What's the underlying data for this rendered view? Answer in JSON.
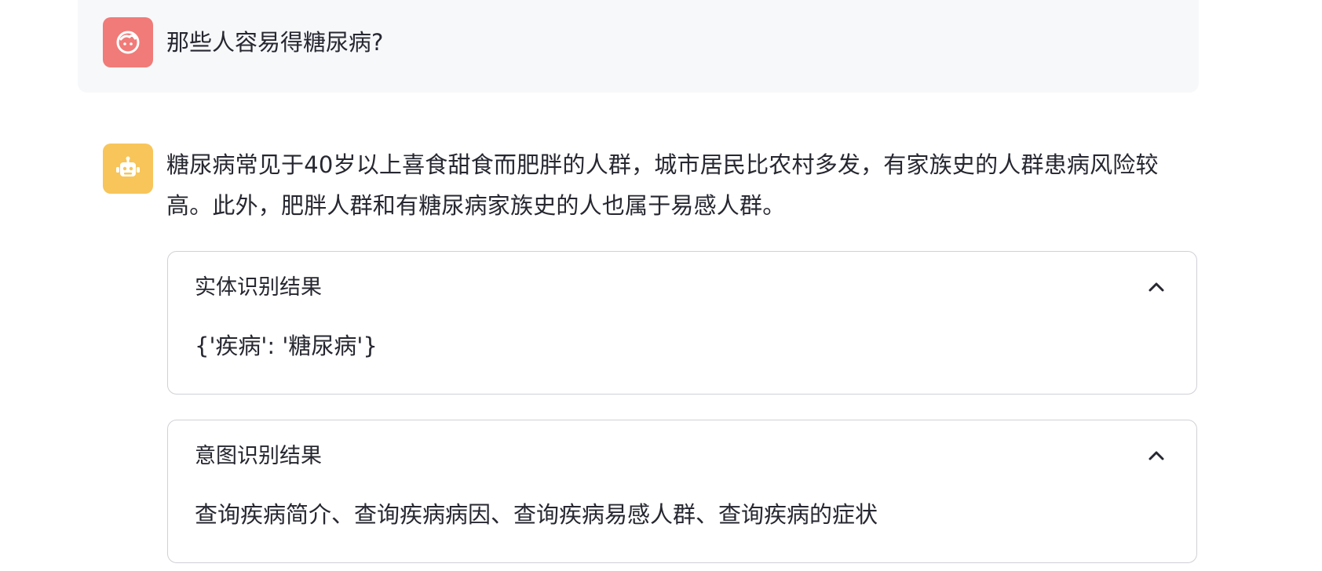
{
  "user_message": {
    "avatar_icon": "user-face-icon",
    "avatar_color": "#f07b78",
    "text": "那些人容易得糖尿病?"
  },
  "assistant_message": {
    "avatar_icon": "robot-icon",
    "avatar_color": "#f7c55a",
    "text": "糖尿病常见于40岁以上喜食甜食而肥胖的人群，城市居民比农村多发，有家族史的人群患病风险较高。此外，肥胖人群和有糖尿病家族史的人也属于易感人群。",
    "expanders": [
      {
        "title": "实体识别结果",
        "expanded": true,
        "icon": "chevron-up-icon",
        "content": "{'疾病': '糖尿病'}"
      },
      {
        "title": "意图识别结果",
        "expanded": true,
        "icon": "chevron-up-icon",
        "content": "查询疾病简介、查询疾病病因、查询疾病易感人群、查询疾病的症状"
      }
    ]
  }
}
